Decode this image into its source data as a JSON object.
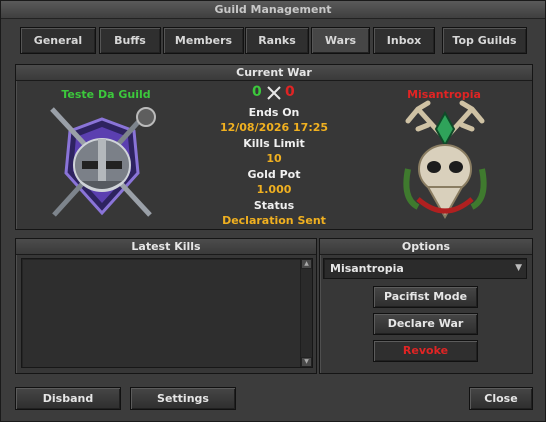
{
  "window": {
    "title": "Guild Management"
  },
  "tabs": [
    "General",
    "Buffs",
    "Members",
    "Ranks",
    "Wars",
    "Inbox",
    "Top Guilds"
  ],
  "current_war": {
    "heading": "Current War",
    "guild_name": "Teste Da Guild",
    "enemy_name": "Misantropia",
    "score_left": "0",
    "score_right": "0",
    "ends_on_label": "Ends On",
    "ends_on_value": "12/08/2026 17:25",
    "kills_limit_label": "Kills Limit",
    "kills_limit_value": "10",
    "gold_pot_label": "Gold Pot",
    "gold_pot_value": "1.000",
    "status_label": "Status",
    "status_value": "Declaration Sent"
  },
  "latest_kills": {
    "heading": "Latest Kills"
  },
  "options": {
    "heading": "Options",
    "selected_guild": "Misantropia",
    "pacifist_label": "Pacifist Mode",
    "declare_label": "Declare War",
    "revoke_label": "Revoke"
  },
  "footer": {
    "disband_label": "Disband",
    "settings_label": "Settings",
    "close_label": "Close"
  },
  "colors": {
    "own_guild": "#3cc83c",
    "enemy_guild": "#e02424",
    "score_left": "#3cc83c",
    "score_right": "#e02424",
    "value": "#f0b020",
    "revoke": "#e02424"
  }
}
